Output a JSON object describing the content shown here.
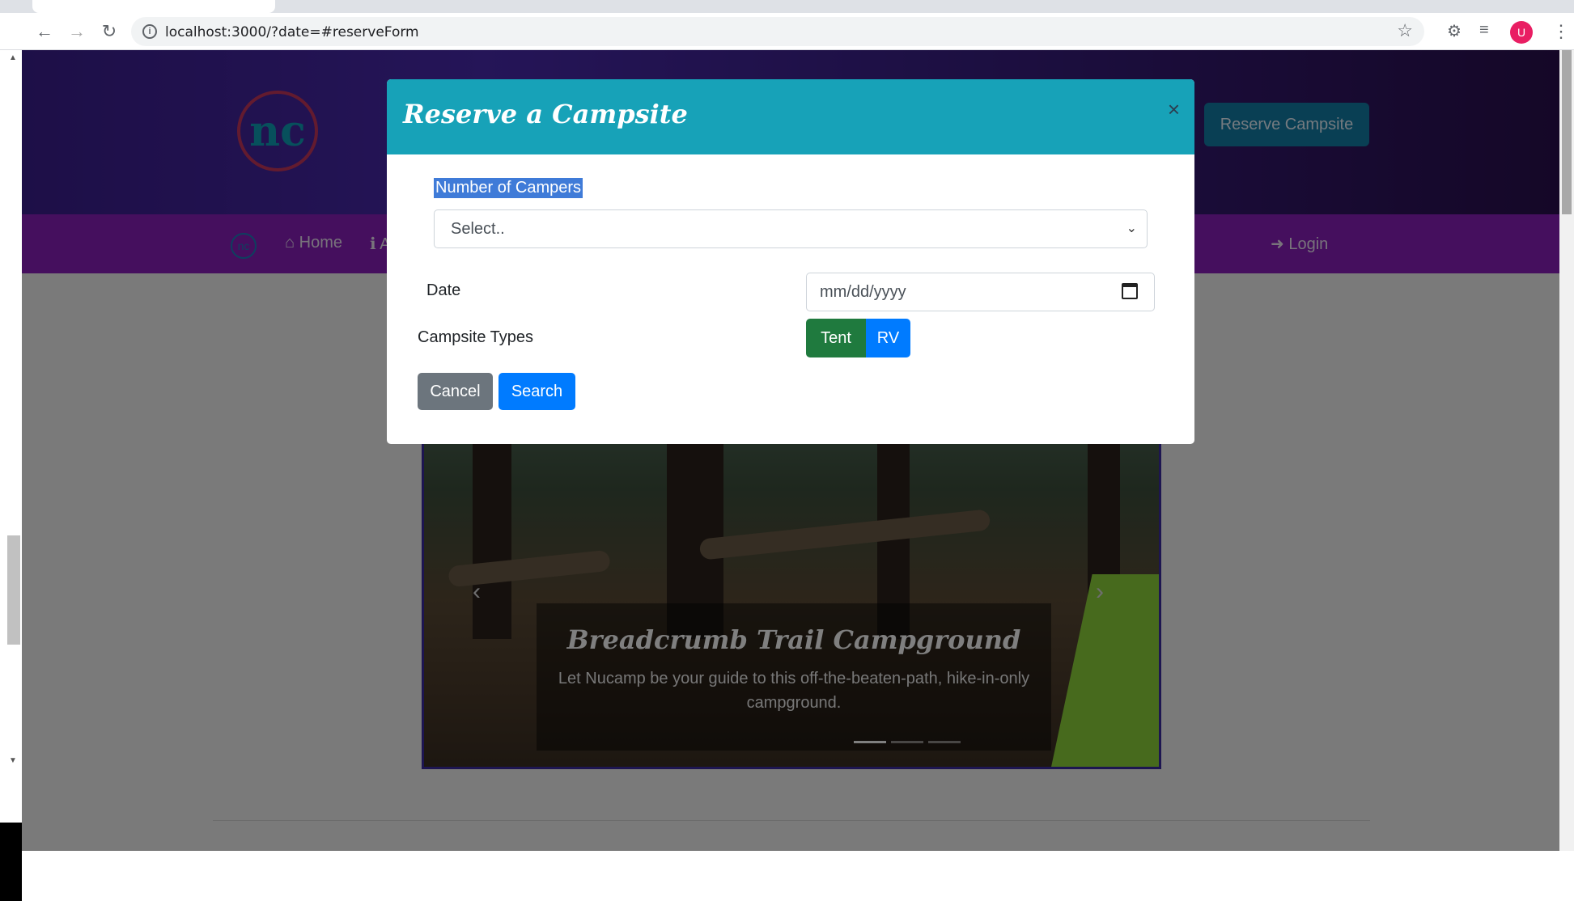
{
  "browser": {
    "url": "localhost:3000/?date=#reserveForm",
    "back_icon": "arrow-left-icon",
    "forward_icon": "arrow-right-icon",
    "reload_icon": "reload-icon",
    "profile_initial": "U"
  },
  "header": {
    "reserve_button": "Reserve Campsite"
  },
  "navbar": {
    "home": "Home",
    "about_partial": "A",
    "login": "Login"
  },
  "carousel": {
    "title": "Breadcrumb Trail Campground",
    "text": "Let Nucamp be your guide to this off-the-beaten-path, hike-in-only campground."
  },
  "modal": {
    "title": "Reserve a Campsite",
    "close": "×",
    "campers_label": "Number of Campers",
    "campers_select_value": "Select..",
    "date_label": "Date",
    "date_placeholder": "mm/dd/yyyy",
    "types_label": "Campsite Types",
    "type_tent": "Tent",
    "type_rv": "RV",
    "cancel": "Cancel",
    "search": "Search"
  },
  "colors": {
    "modal_header": "#17a2b8",
    "tent_active": "#1f7a3e",
    "primary": "#007bff",
    "secondary": "#6c757d"
  }
}
